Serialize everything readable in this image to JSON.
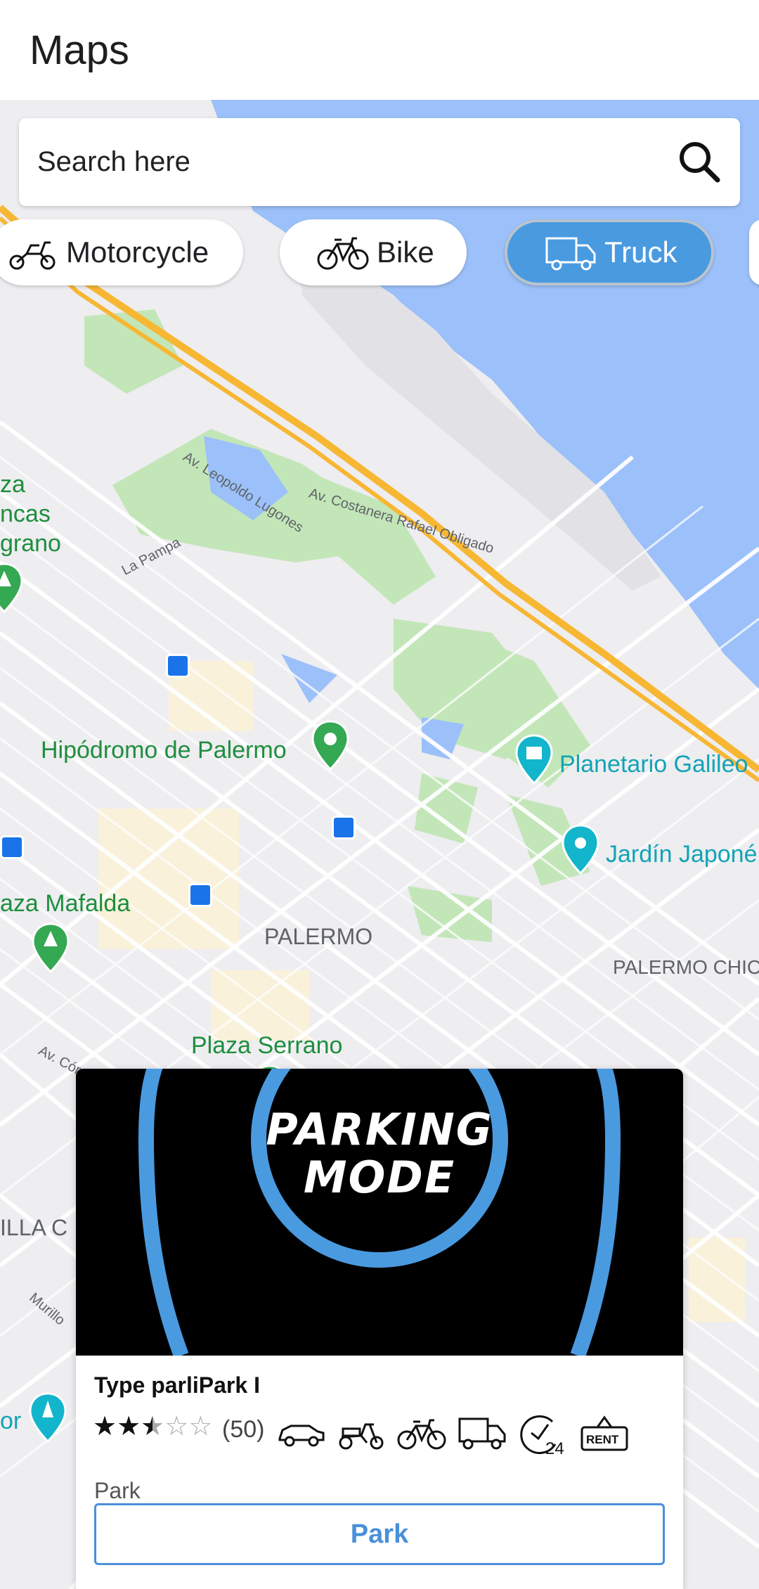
{
  "appbar": {
    "title": "Maps"
  },
  "search": {
    "placeholder": "Search here",
    "icon": "search-icon"
  },
  "chips": [
    {
      "label": "Motorcycle",
      "icon": "motorcycle-icon",
      "active": false
    },
    {
      "label": "Bike",
      "icon": "bike-icon",
      "active": false
    },
    {
      "label": "Truck",
      "icon": "truck-icon",
      "active": true
    }
  ],
  "map": {
    "places": [
      {
        "name": "Hipódromo de Palermo",
        "kind": "park"
      },
      {
        "name": "Planetario Galileo",
        "kind": "museum"
      },
      {
        "name": "Jardín Japoné",
        "kind": "attraction"
      },
      {
        "name": "aza Mafalda",
        "kind": "park"
      },
      {
        "name": "Plaza Serrano",
        "kind": "park"
      },
      {
        "name": "za",
        "kind": "park"
      },
      {
        "name": "ncas",
        "kind": "park"
      },
      {
        "name": "grano",
        "kind": "park"
      },
      {
        "name": "or",
        "kind": "attraction"
      }
    ],
    "areas": [
      "PALERMO",
      "PALERMO CHIC",
      "ILLA C"
    ],
    "roads": [
      "Av. Leopoldo Lugones",
      "Av. Costanera Rafael Obligado",
      "La Pampa",
      "Av. Córdoba",
      "Murillo"
    ]
  },
  "card": {
    "banner_line1": "PARKING",
    "banner_line2": "MODE",
    "title": "Type parliPark I",
    "rating": 2.5,
    "rating_max": 5,
    "review_count": "(50)",
    "amenities": [
      "car-icon",
      "scooter-icon",
      "bike-icon",
      "truck-icon",
      "24-hours-icon",
      "rent-sign-icon"
    ],
    "type": "Park",
    "button_label": "Park",
    "accent": "#4a90d9"
  },
  "colors": {
    "chip_active": "#4a9ae0",
    "water": "#9cc0f9",
    "park": "#c3e6b8",
    "highway": "#f7b733"
  }
}
